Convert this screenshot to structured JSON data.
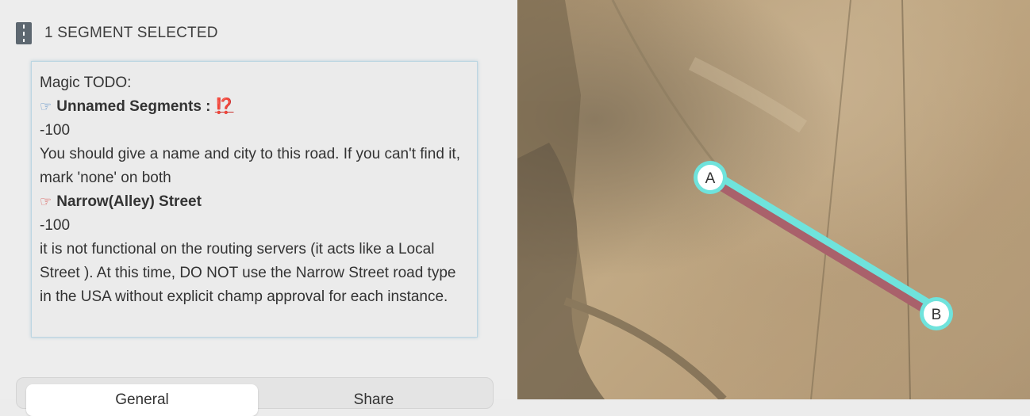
{
  "selection": {
    "icon": "road-icon",
    "title": "1 SEGMENT SELECTED"
  },
  "todo": {
    "heading": "Magic TODO:",
    "items": [
      {
        "icon": "pointing-hand-icon",
        "title": "Unnamed Segments :",
        "badge": "⁉️",
        "score": "-100",
        "description": "You should give a name and city to this road. If you can't find it, mark 'none' on both"
      },
      {
        "icon": "pointing-hand-icon",
        "title": "Narrow(Alley) Street",
        "score": "-100",
        "description": "it is not functional on the routing servers (it acts like a Local Street ). At this time, DO NOT use the Narrow Street road type in the USA without explicit champ approval for each instance."
      }
    ]
  },
  "tabs": [
    {
      "label": "General",
      "active": true
    },
    {
      "label": "Share",
      "active": false
    }
  ],
  "map": {
    "segment_colors": {
      "outline": "#a9616b",
      "highlight": "#6fe3dc"
    },
    "nodes": [
      {
        "label": "A"
      },
      {
        "label": "B"
      }
    ]
  }
}
